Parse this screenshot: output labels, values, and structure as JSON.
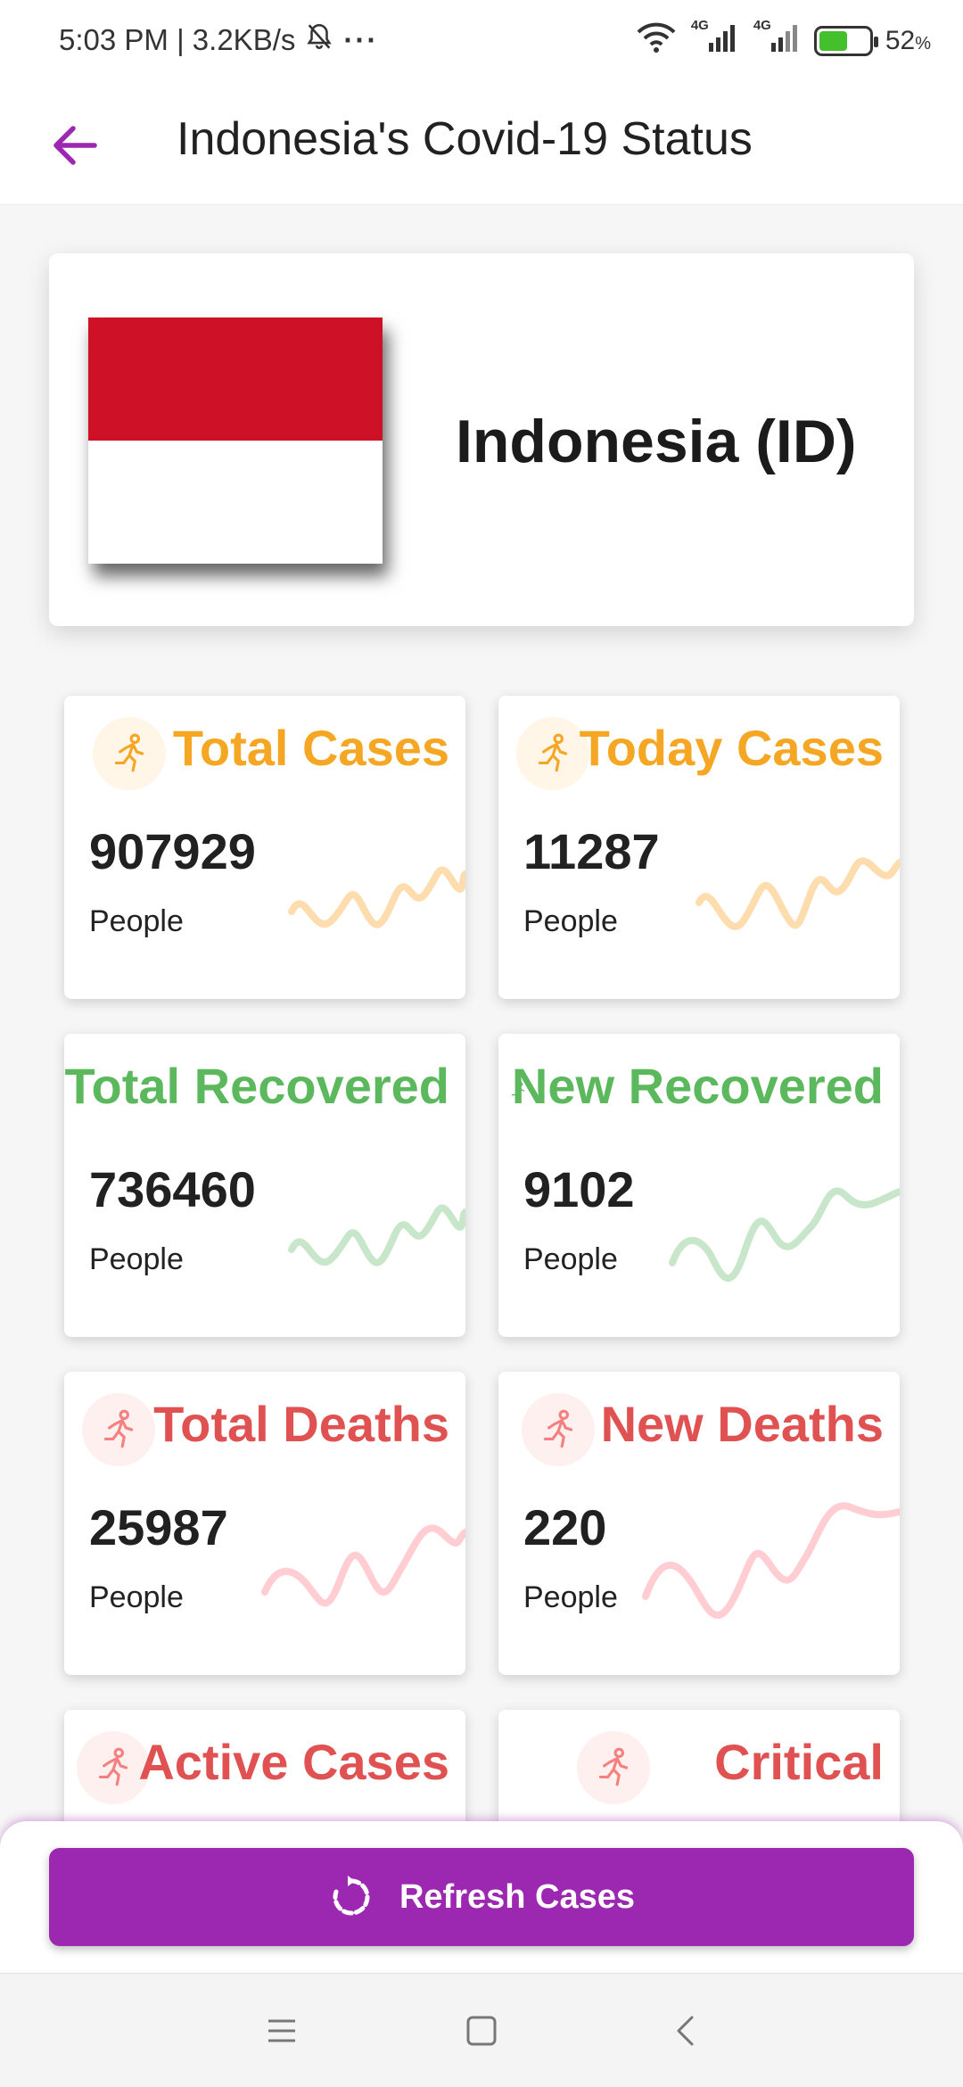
{
  "status_bar": {
    "time": "5:03 PM | 3.2KB/s",
    "battery": "52",
    "battery_unit": "%",
    "net_label_1": "4G",
    "net_label_2": "4G",
    "overflow": "···"
  },
  "app_bar": {
    "title": "Indonesia's Covid-19 Status",
    "back_icon": "arrow-back-icon"
  },
  "country": {
    "name": "Indonesia (ID)",
    "flag_colors": [
      "#ce1126",
      "#ffffff"
    ]
  },
  "stats": [
    {
      "title": "Total Cases",
      "value": "907929",
      "unit": "People",
      "color": "#f5a623",
      "icon": "running-person-icon"
    },
    {
      "title": "Today Cases",
      "value": "11287",
      "unit": "People",
      "color": "#f5a623",
      "icon": "running-person-icon"
    },
    {
      "title": "Total Recovered",
      "value": "736460",
      "unit": "People",
      "color": "#5cb85c",
      "icon": "running-person-icon"
    },
    {
      "title": "New Recovered",
      "value": "9102",
      "unit": "People",
      "color": "#5cb85c",
      "icon": "running-person-icon"
    },
    {
      "title": "Total Deaths",
      "value": "25987",
      "unit": "People",
      "color": "#e05252",
      "icon": "running-person-icon"
    },
    {
      "title": "New Deaths",
      "value": "220",
      "unit": "People",
      "color": "#e05252",
      "icon": "running-person-icon"
    },
    {
      "title": "Active Cases",
      "color": "#e05252",
      "icon": "running-person-icon"
    },
    {
      "title": "Critical",
      "color": "#e05252",
      "icon": "running-person-icon"
    }
  ],
  "refresh": {
    "label": "Refresh Cases",
    "icon": "refresh-icon",
    "color": "#9c27b0"
  },
  "nav": {
    "menu_icon": "menu-icon",
    "home_icon": "home-square-icon",
    "back_icon": "nav-back-icon"
  }
}
